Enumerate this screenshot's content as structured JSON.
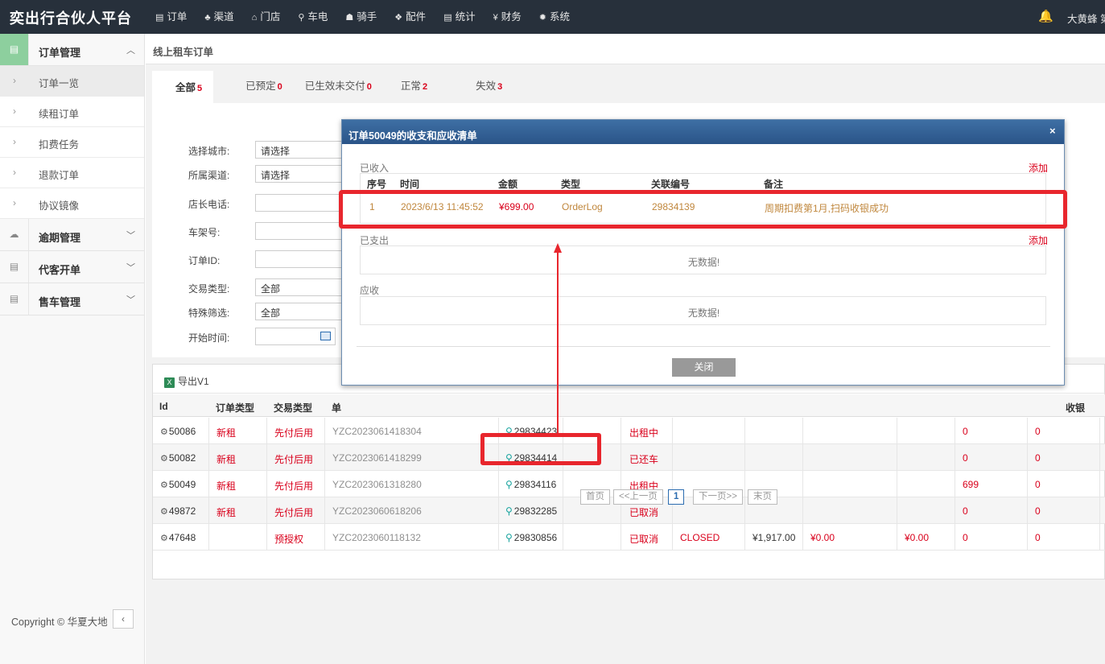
{
  "brand": "奕出行合伙人平台",
  "nav": [
    {
      "icon": "list-icon",
      "glyph": "▤",
      "label": "订单"
    },
    {
      "icon": "sitemap-icon",
      "glyph": "♣",
      "label": "渠道"
    },
    {
      "icon": "home-icon",
      "glyph": "⌂",
      "label": "门店"
    },
    {
      "icon": "motorbike-icon",
      "glyph": "⚲",
      "label": "车电"
    },
    {
      "icon": "users-icon",
      "glyph": "☗",
      "label": "骑手"
    },
    {
      "icon": "cubes-icon",
      "glyph": "❖",
      "label": "配件"
    },
    {
      "icon": "table-icon",
      "glyph": "▤",
      "label": "统计"
    },
    {
      "icon": "yen-icon",
      "glyph": "¥",
      "label": "财务"
    },
    {
      "icon": "gear-icon",
      "glyph": "✹",
      "label": "系统"
    }
  ],
  "user": "大黄蜂 第",
  "sidebar": {
    "groups": [
      {
        "label": "订单管理",
        "icon": "list-icon",
        "open": true,
        "items": [
          "订单一览",
          "续租订单",
          "扣费任务",
          "退款订单",
          "协议镜像"
        ]
      },
      {
        "label": "逾期管理",
        "icon": "cloud-icon",
        "open": false,
        "items": []
      },
      {
        "label": "代客开单",
        "icon": "list-icon",
        "open": false,
        "items": []
      },
      {
        "label": "售车管理",
        "icon": "list-icon",
        "open": false,
        "items": []
      }
    ],
    "copyright": "Copyright © 华夏大地",
    "collapse": "‹"
  },
  "breadcrumb": "线上租车订单",
  "tabs": [
    {
      "label": "全部",
      "count": "5"
    },
    {
      "label": "已预定",
      "count": "0"
    },
    {
      "label": "已生效未交付",
      "count": "0"
    },
    {
      "label": "正常",
      "count": "2"
    },
    {
      "label": "失效",
      "count": "3"
    }
  ],
  "filters": {
    "city_label": "选择城市:",
    "city_value": "请选择",
    "channel_label": "所属渠道:",
    "channel_value": "请选择",
    "phone_label": "店长电话:",
    "frame_label": "车架号:",
    "orderid_label": "订单ID:",
    "trade_label": "交易类型:",
    "trade_value": "全部",
    "special_label": "特殊筛选:",
    "special_value": "全部",
    "start_label": "开始时间:"
  },
  "toolbar": {
    "export_label": "导出V1"
  },
  "table": {
    "headers": {
      "id": "Id",
      "order_type": "订单类型",
      "trade_type": "交易类型",
      "order_no": "单",
      "last": "收银"
    },
    "rows": [
      {
        "id": "50086",
        "type": "新租",
        "trade": "先付后用",
        "no": "YZC2023061418304",
        "rel": "29834423",
        "status": "出租中",
        "c1": "",
        "c2": "",
        "c3": "",
        "c4": "",
        "v1": "0",
        "v2": "0"
      },
      {
        "id": "50082",
        "type": "新租",
        "trade": "先付后用",
        "no": "YZC2023061418299",
        "rel": "29834414",
        "status": "已还车",
        "c1": "",
        "c2": "",
        "c3": "",
        "c4": "",
        "v1": "0",
        "v2": "0"
      },
      {
        "id": "50049",
        "type": "新租",
        "trade": "先付后用",
        "no": "YZC2023061318280",
        "rel": "29834116",
        "status": "出租中",
        "c1": "",
        "c2": "",
        "c3": "",
        "c4": "",
        "v1": "699",
        "v2": "0"
      },
      {
        "id": "49872",
        "type": "新租",
        "trade": "先付后用",
        "no": "YZC2023060618206",
        "rel": "29832285",
        "status": "已取消",
        "c1": "",
        "c2": "",
        "c3": "",
        "c4": "",
        "v1": "0",
        "v2": "0"
      },
      {
        "id": "47648",
        "type": "",
        "trade": "预授权",
        "no": "YZC2023060118132",
        "rel": "29830856",
        "status": "已取消",
        "c1": "CLOSED",
        "c2": "¥1,917.00",
        "c3": "¥0.00",
        "c4": "¥0.00",
        "v1": "0",
        "v2": "0"
      }
    ]
  },
  "pager": {
    "first": "首页",
    "prev": "<<上一页",
    "current": "1",
    "next": "下一页>>",
    "last": "末页"
  },
  "modal": {
    "title": "订单50049的收支和应收清单",
    "close_x": "×",
    "received_label": "已收入",
    "received_add": "添加",
    "headers": {
      "seq": "序号",
      "time": "时间",
      "amount": "金额",
      "type": "类型",
      "ref": "关联编号",
      "note": "备注"
    },
    "received_rows": [
      {
        "seq": "1",
        "time": "2023/6/13 11:45:52",
        "amount": "¥699.00",
        "type": "OrderLog",
        "ref": "29834139",
        "note": "周期扣费第1月,扫码收银成功"
      }
    ],
    "paid_label": "已支出",
    "paid_add": "添加",
    "paid_empty": "无数据!",
    "due_label": "应收",
    "due_empty": "无数据!",
    "close_button": "关闭"
  },
  "colors": {
    "accent_red": "#e8262d",
    "topbar": "#27303b",
    "modal_header": "#2f5d95"
  }
}
